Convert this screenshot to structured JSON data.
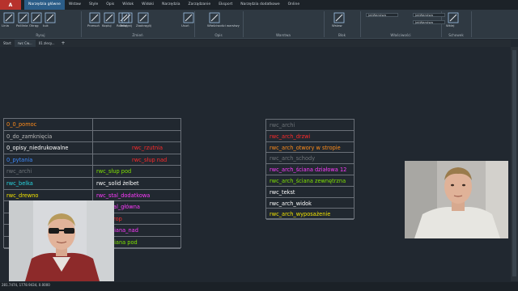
{
  "app": {
    "logo_text": "A"
  },
  "ribbon_tabs": [
    {
      "label": "Narzędzia główne",
      "active": true
    },
    {
      "label": "Wstaw",
      "active": false
    },
    {
      "label": "Style",
      "active": false
    },
    {
      "label": "Opis",
      "active": false
    },
    {
      "label": "Widok",
      "active": false
    },
    {
      "label": "Widoki",
      "active": false
    },
    {
      "label": "Narzędzia",
      "active": false
    },
    {
      "label": "Zarządzanie",
      "active": false
    },
    {
      "label": "Eksport",
      "active": false
    },
    {
      "label": "Narzędzia dodatkowe",
      "active": false
    },
    {
      "label": "Online",
      "active": false
    }
  ],
  "ribbon": {
    "tools": [
      "Linia",
      "Polilinia",
      "Okrąg",
      "Łuk",
      "Przesuń",
      "Kopiuj",
      "Rozciągnij",
      "Zaokrąglij",
      "Tekst",
      "Usuń",
      "Właściwości warstwy",
      "Wstaw",
      "Wklej"
    ],
    "groups": [
      "Rysuj",
      "Zmień",
      "Opis",
      "Warstwa",
      "Blok",
      "Właściwości",
      "Schowek"
    ],
    "props": {
      "color": "JakWarstwa",
      "linetype": "JakWarstwa",
      "lineweight": "JakWarstwa"
    }
  },
  "drawing_tabs": [
    {
      "label": "Start",
      "active": false
    },
    {
      "label": "rwc Cw...",
      "active": true
    },
    {
      "label": "01 zlecy...",
      "active": false
    }
  ],
  "status_bar": {
    "coords": "281.7474, 1778.9434, 0.0000"
  },
  "left_table": {
    "col1": [
      {
        "text": "0_0_pomoc",
        "color": "#ff8c1a"
      },
      {
        "text": "0_do_zamknięcia",
        "color": "#b9b9b9"
      },
      {
        "text": "0_opisy_niedrukowalne",
        "color": "#ffffff"
      },
      {
        "text": "0_pytania",
        "color": "#3d8bff"
      },
      {
        "text": "rwc_archi",
        "color": "#6f7479"
      },
      {
        "text": "rwc_belka",
        "color": "#28d6e0"
      },
      {
        "text": "rwc_drewno",
        "color": "#f2e300"
      },
      {
        "text": "",
        "color": "#ffffff"
      },
      {
        "text": "",
        "color": "#ffffff"
      },
      {
        "text": "",
        "color": "#ffffff"
      }
    ],
    "col2": [
      {
        "text": "",
        "color": "#ffffff"
      },
      {
        "text": "",
        "color": "#ffffff"
      },
      {
        "text": "rwc_rzutnia",
        "color": "#ff2a2a"
      },
      {
        "text": "rwc_słup nad",
        "color": "#ff2a2a"
      },
      {
        "text": "rwc_słup pod",
        "color": "#7fe300"
      },
      {
        "text": "rwc_solid żelbet",
        "color": "#ffffff"
      },
      {
        "text": "rwc_stal_dodatkowa",
        "color": "#ff3aff"
      },
      {
        "text": "rwc_stal_główna",
        "color": "#ff3aff"
      },
      {
        "text": "rwc_strop",
        "color": "#ff2a2a"
      },
      {
        "text": "rwc_ściana_nad",
        "color": "#ff3aff"
      },
      {
        "text": "rwc_ściana pod",
        "color": "#7fe300"
      }
    ]
  },
  "right_table": [
    {
      "text": "rwc_archi",
      "color": "#6f7479"
    },
    {
      "text": "rwc_arch_drzwi",
      "color": "#ff2a2a"
    },
    {
      "text": "rwc_arch_otwory w stropie",
      "color": "#ff8c1a"
    },
    {
      "text": "rwc_arch_schody",
      "color": "#6f7479"
    },
    {
      "text": "rwc_arch_ściana działowa 12",
      "color": "#ff3aff"
    },
    {
      "text": "rwc_arch_ściana zewnętrzna",
      "color": "#7fe300"
    },
    {
      "text": "rwc_tekst",
      "color": "#ffffff"
    },
    {
      "text": "rwc_arch_widok",
      "color": "#ffffff"
    },
    {
      "text": "rwc_arch_wyposażenie",
      "color": "#f2e300"
    }
  ]
}
